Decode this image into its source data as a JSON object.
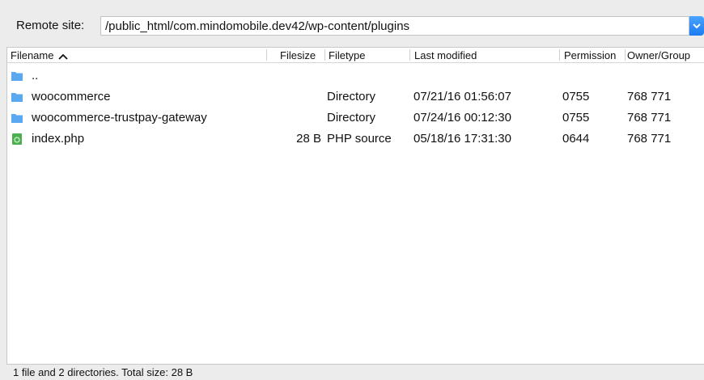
{
  "remote_site": {
    "label": "Remote site:",
    "path": "/public_html/com.mindomobile.dev42/wp-content/plugins"
  },
  "columns": {
    "filename": "Filename",
    "filesize": "Filesize",
    "filetype": "Filetype",
    "last_modified": "Last modified",
    "permissions": "Permission",
    "owner_group": "Owner/Group"
  },
  "files": [
    {
      "name": "..",
      "icon": "folder-icon",
      "size": "",
      "type": "",
      "modified": "",
      "perm": "",
      "owner": ""
    },
    {
      "name": "woocommerce",
      "icon": "folder-icon",
      "size": "",
      "type": "Directory",
      "modified": "07/21/16 01:56:07",
      "perm": "0755",
      "owner": "768 771"
    },
    {
      "name": "woocommerce-trustpay-gateway",
      "icon": "folder-icon",
      "size": "",
      "type": "Directory",
      "modified": "07/24/16 00:12:30",
      "perm": "0755",
      "owner": "768 771"
    },
    {
      "name": "index.php",
      "icon": "php-file-icon",
      "size": "28 B",
      "type": "PHP source",
      "modified": "05/18/16 17:31:30",
      "perm": "0644",
      "owner": "768 771"
    }
  ],
  "status": "1 file and 2 directories. Total size: 28 B",
  "colors": {
    "accent": "#1a7bf2",
    "folder": "#5aa9f0",
    "php": "#4caf50"
  }
}
